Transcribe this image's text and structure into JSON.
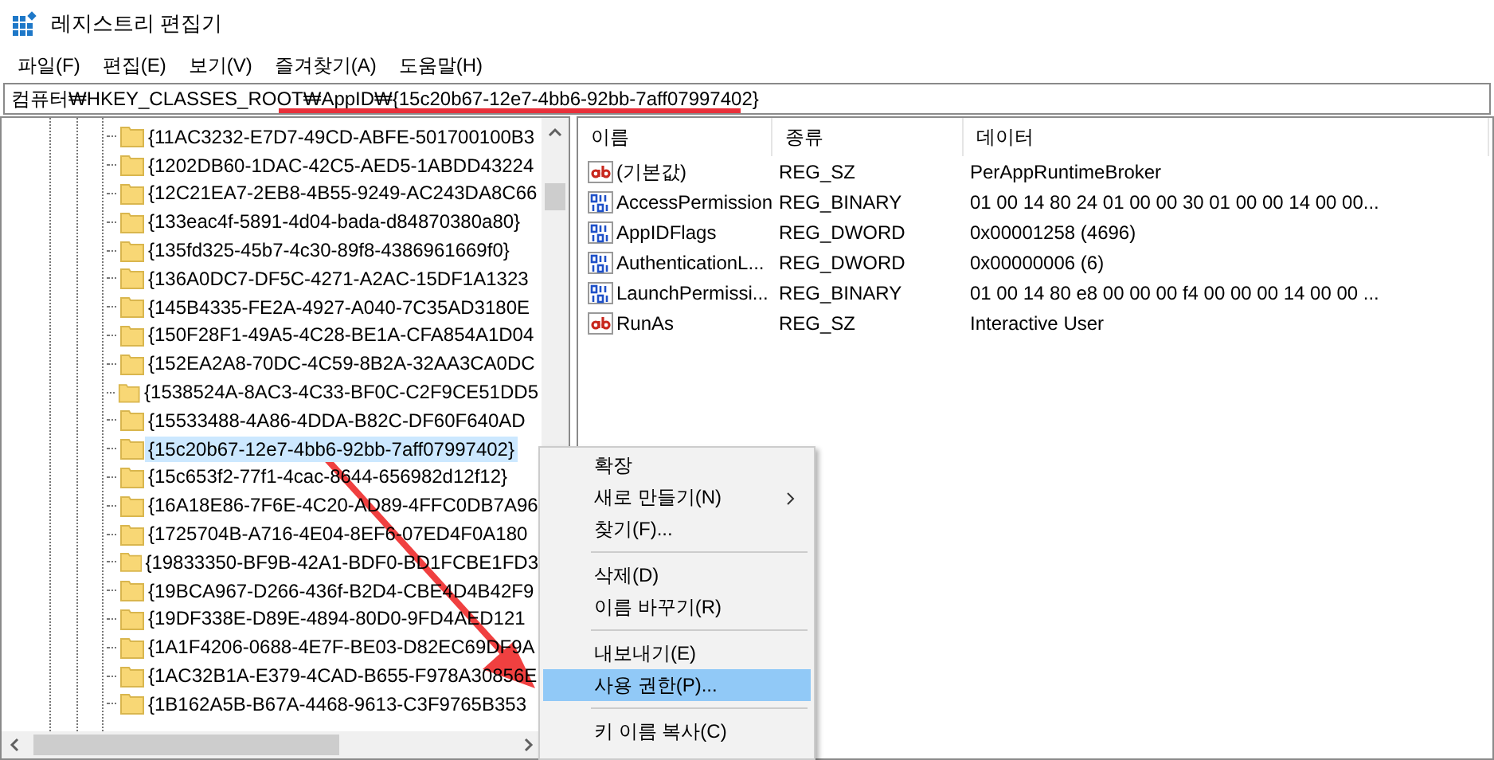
{
  "window": {
    "title": "레지스트리 편집기"
  },
  "menu": [
    {
      "label": "파일(F)"
    },
    {
      "label": "편집(E)"
    },
    {
      "label": "보기(V)"
    },
    {
      "label": "즐겨찾기(A)"
    },
    {
      "label": "도움말(H)"
    }
  ],
  "address": "컴퓨터₩HKEY_CLASSES_ROOT₩AppID₩{15c20b67-12e7-4bb6-92bb-7aff07997402}",
  "tree": {
    "items": [
      {
        "label": "{11AC3232-E7D7-49CD-ABFE-501700100B3",
        "selected": false
      },
      {
        "label": "{1202DB60-1DAC-42C5-AED5-1ABDD43224",
        "selected": false
      },
      {
        "label": "{12C21EA7-2EB8-4B55-9249-AC243DA8C66",
        "selected": false
      },
      {
        "label": "{133eac4f-5891-4d04-bada-d84870380a80}",
        "selected": false
      },
      {
        "label": "{135fd325-45b7-4c30-89f8-4386961669f0}",
        "selected": false
      },
      {
        "label": "{136A0DC7-DF5C-4271-A2AC-15DF1A1323",
        "selected": false
      },
      {
        "label": "{145B4335-FE2A-4927-A040-7C35AD3180E",
        "selected": false
      },
      {
        "label": "{150F28F1-49A5-4C28-BE1A-CFA854A1D04",
        "selected": false
      },
      {
        "label": "{152EA2A8-70DC-4C59-8B2A-32AA3CA0DC",
        "selected": false
      },
      {
        "label": "{1538524A-8AC3-4C33-BF0C-C2F9CE51DD5",
        "selected": false
      },
      {
        "label": "{15533488-4A86-4DDA-B82C-DF60F640AD",
        "selected": false
      },
      {
        "label": "{15c20b67-12e7-4bb6-92bb-7aff07997402}",
        "selected": true
      },
      {
        "label": "{15c653f2-77f1-4cac-8644-656982d12f12}",
        "selected": false
      },
      {
        "label": "{16A18E86-7F6E-4C20-AD89-4FFC0DB7A96",
        "selected": false
      },
      {
        "label": "{1725704B-A716-4E04-8EF6-07ED4F0A180",
        "selected": false
      },
      {
        "label": "{19833350-BF9B-42A1-BDF0-BD1FCBE1FD3",
        "selected": false
      },
      {
        "label": "{19BCA967-D266-436f-B2D4-CBE4D4B42F9",
        "selected": false
      },
      {
        "label": "{19DF338E-D89E-4894-80D0-9FD4AED121",
        "selected": false
      },
      {
        "label": "{1A1F4206-0688-4E7F-BE03-D82EC69DF9A",
        "selected": false
      },
      {
        "label": "{1AC32B1A-E379-4CAD-B655-F978A30856E",
        "selected": false
      },
      {
        "label": "{1B162A5B-B67A-4468-9613-C3F9765B353",
        "selected": false
      }
    ]
  },
  "values": {
    "columns": [
      "이름",
      "종류",
      "데이터"
    ],
    "rows": [
      {
        "kind": "string",
        "name": "(기본값)",
        "type": "REG_SZ",
        "data": "PerAppRuntimeBroker"
      },
      {
        "kind": "binary",
        "name": "AccessPermission",
        "type": "REG_BINARY",
        "data": "01 00 14 80 24 01 00 00 30 01 00 00 14 00 00..."
      },
      {
        "kind": "binary",
        "name": "AppIDFlags",
        "type": "REG_DWORD",
        "data": "0x00001258 (4696)"
      },
      {
        "kind": "binary",
        "name": "AuthenticationL...",
        "type": "REG_DWORD",
        "data": "0x00000006 (6)"
      },
      {
        "kind": "binary",
        "name": "LaunchPermissi...",
        "type": "REG_BINARY",
        "data": "01 00 14 80 e8 00 00 00 f4 00 00 00 14 00 00 ..."
      },
      {
        "kind": "string",
        "name": "RunAs",
        "type": "REG_SZ",
        "data": "Interactive User"
      }
    ]
  },
  "context_menu": {
    "items": [
      {
        "kind": "item",
        "label": "확장",
        "submenu": false,
        "selected": false
      },
      {
        "kind": "item",
        "label": "새로 만들기(N)",
        "submenu": true,
        "selected": false
      },
      {
        "kind": "item",
        "label": "찾기(F)...",
        "submenu": false,
        "selected": false
      },
      {
        "kind": "separator"
      },
      {
        "kind": "item",
        "label": "삭제(D)",
        "submenu": false,
        "selected": false
      },
      {
        "kind": "item",
        "label": "이름 바꾸기(R)",
        "submenu": false,
        "selected": false
      },
      {
        "kind": "separator"
      },
      {
        "kind": "item",
        "label": "내보내기(E)",
        "submenu": false,
        "selected": false
      },
      {
        "kind": "item",
        "label": "사용 권한(P)...",
        "submenu": false,
        "selected": true
      },
      {
        "kind": "separator"
      },
      {
        "kind": "item",
        "label": "키 이름 복사(C)",
        "submenu": false,
        "selected": false
      }
    ]
  },
  "annotations": {
    "address_underline": true,
    "arrow_to_menu": true
  }
}
